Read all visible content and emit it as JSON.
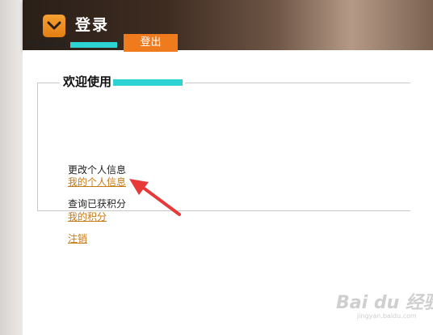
{
  "header": {
    "title": "登录",
    "logo_icon": "chevron-down-icon",
    "logo_color": "#f08a1c"
  },
  "welcome": {
    "text": "欢迎使用."
  },
  "logout_button": {
    "label": "登出",
    "color": "#f07b1d"
  },
  "panel": {
    "legend": "欢迎使用"
  },
  "items": [
    {
      "label": "更改个人信息",
      "link": "我的个人信息"
    },
    {
      "label": "查询已获积分",
      "link": "我的积分"
    }
  ],
  "cancel_link": "注销",
  "annotation_arrow_color": "#e8393a",
  "redaction_color": "#2cd3d2",
  "watermark": {
    "brand": "Bai du 经验",
    "url": "jingyan.baidu.com"
  }
}
